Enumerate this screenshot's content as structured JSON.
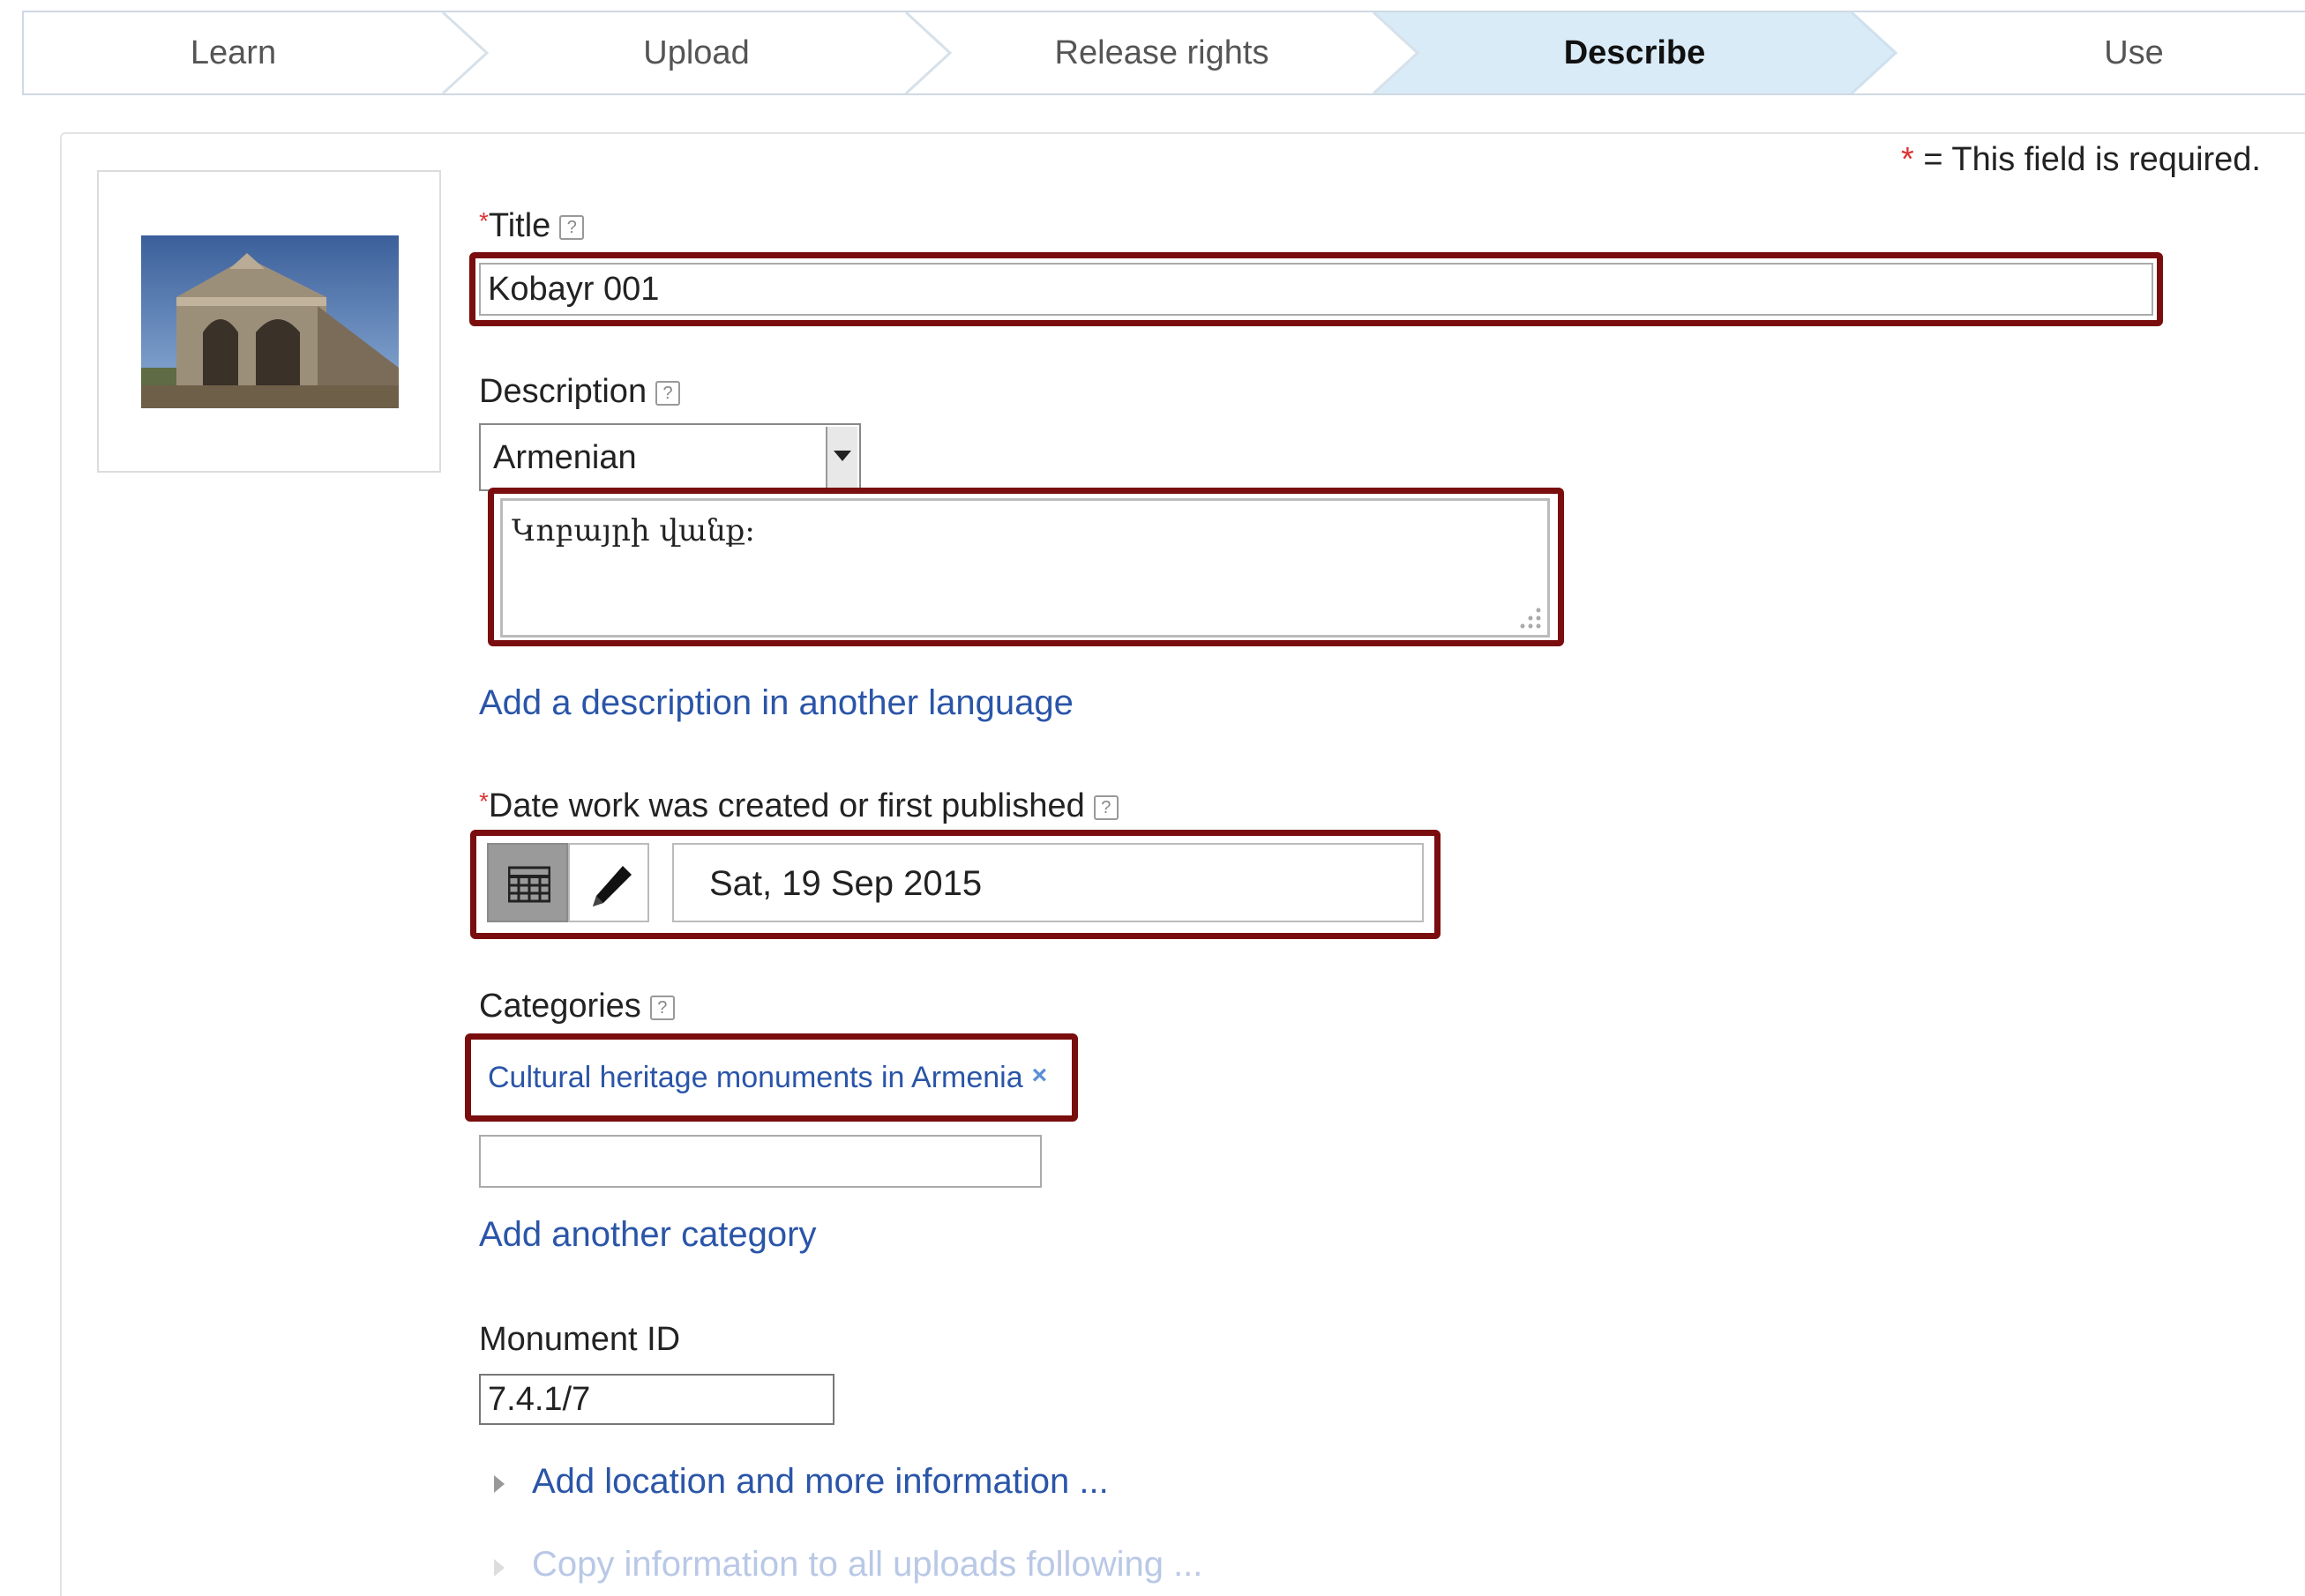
{
  "steps": [
    {
      "label": "Learn",
      "active": false
    },
    {
      "label": "Upload",
      "active": false
    },
    {
      "label": "Release rights",
      "active": false
    },
    {
      "label": "Describe",
      "active": true
    },
    {
      "label": "Use",
      "active": false
    }
  ],
  "required_note": {
    "star": "*",
    "text": " = This field is required."
  },
  "form": {
    "title": {
      "star": "*",
      "label": "Title",
      "help": "?",
      "value": "Kobayr 001"
    },
    "description": {
      "label": "Description",
      "help": "?",
      "language": "Armenian",
      "text": "Կոբայրի վանք։",
      "add_language_link": "Add a description in another language"
    },
    "date": {
      "star": "*",
      "label": "Date work was created or first published",
      "help": "?",
      "value": "Sat, 19 Sep 2015"
    },
    "categories": {
      "label": "Categories",
      "help": "?",
      "chips": [
        "Cultural heritage monuments in Armenia"
      ],
      "chip_remove": "×",
      "input_value": "",
      "add_link": "Add another category"
    },
    "monument_id": {
      "label": "Monument ID",
      "value": "7.4.1/7"
    },
    "more_info_link": "Add location and more information ...",
    "copy_info_link": "Copy information to all uploads following ..."
  },
  "colors": {
    "highlight": "#7a0d0d",
    "link": "#2a55a8",
    "active_step": "#d9ebf7",
    "required": "#dd3333"
  }
}
